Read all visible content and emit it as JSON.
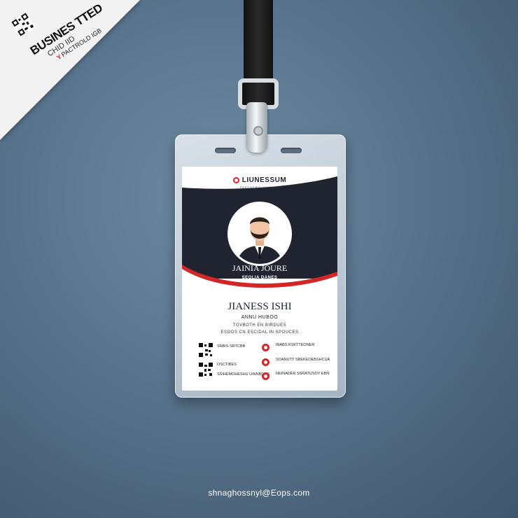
{
  "corner": {
    "title": "BUSINES TTED",
    "line2": "CHID IID",
    "line3_mark": "Y",
    "line3": "PACTROLD IGB"
  },
  "card": {
    "brand": "LIUNESSUM",
    "brand_sub": "FARENERO ANIPOTE",
    "name_top": "JAINIA JOURE",
    "title_top": "SEOLIA DANES",
    "name_main": "JIANESS ISHI",
    "line2": "ANNU HUBOO",
    "line3": "TOVBOTH EN BIRDUES",
    "line4": "ESOOS CN ESCIDAL IN SPOUCES",
    "left_items": [
      "SNBIS SRTCBB",
      "OSCTIBES",
      "SSIHEMOHESHU UINNBOCS"
    ],
    "right_items": [
      "INABS KSKTTEONER",
      "SOANUTY SBEKEOEBSHCUA",
      "NEINADER SSRATUSOY EBN"
    ]
  },
  "footer": {
    "email": "shnaghossnyl@Eops.com"
  },
  "colors": {
    "accent": "#d32626",
    "navy": "#1f2430",
    "background": "#5b7690"
  }
}
